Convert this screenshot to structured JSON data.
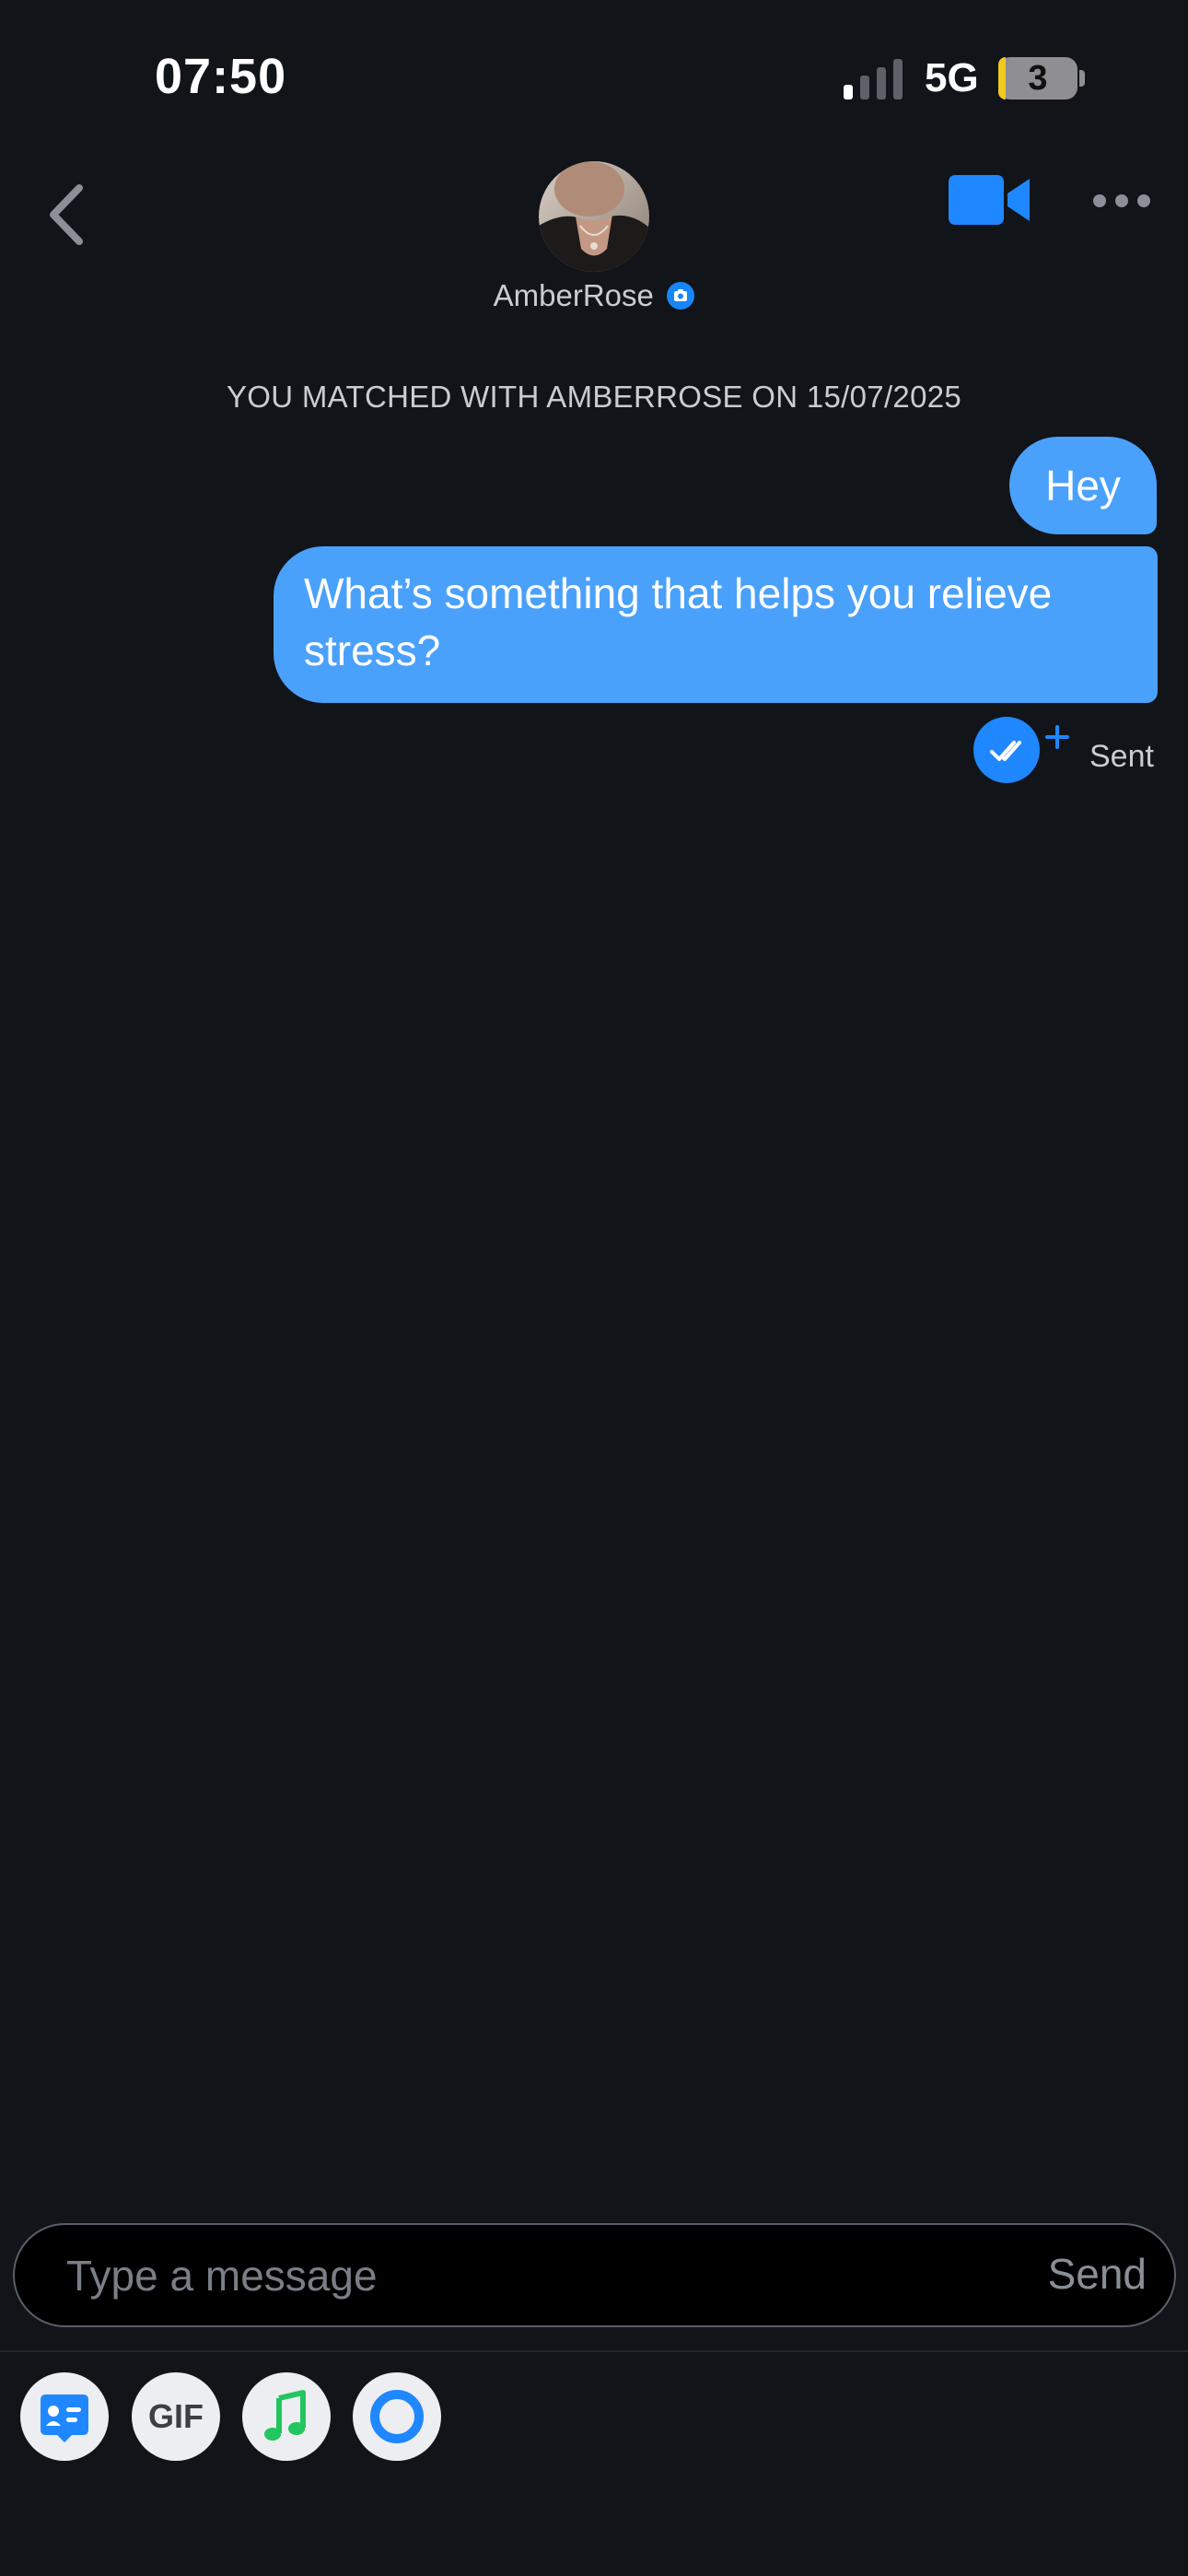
{
  "status_bar": {
    "time": "07:50",
    "network": "5G",
    "battery": "3",
    "battery_fill_color": "#f2c91e"
  },
  "header": {
    "back_icon": "chevron-left-icon",
    "match_name": "AmberRose",
    "verified_icon": "camera-verified-icon",
    "video_icon": "video-call-icon",
    "more_icon": "more-dots-icon"
  },
  "conversation": {
    "matched_text": "YOU MATCHED WITH AMBERROSE ON 15/07/2025",
    "messages": [
      {
        "from": "me",
        "text": "Hey"
      },
      {
        "from": "me",
        "text": "What’s something that helps you relieve stress?"
      }
    ],
    "read_status_icon": "double-check-icon",
    "status": "Sent",
    "bubble_color": "#4aa1fb"
  },
  "composer": {
    "placeholder": "Type a message",
    "send_label": "Send"
  },
  "toolbar": {
    "tools": [
      {
        "icon": "sticker-card-icon"
      },
      {
        "label": "GIF"
      },
      {
        "icon": "music-note-icon"
      },
      {
        "icon": "ring-icon"
      }
    ]
  }
}
